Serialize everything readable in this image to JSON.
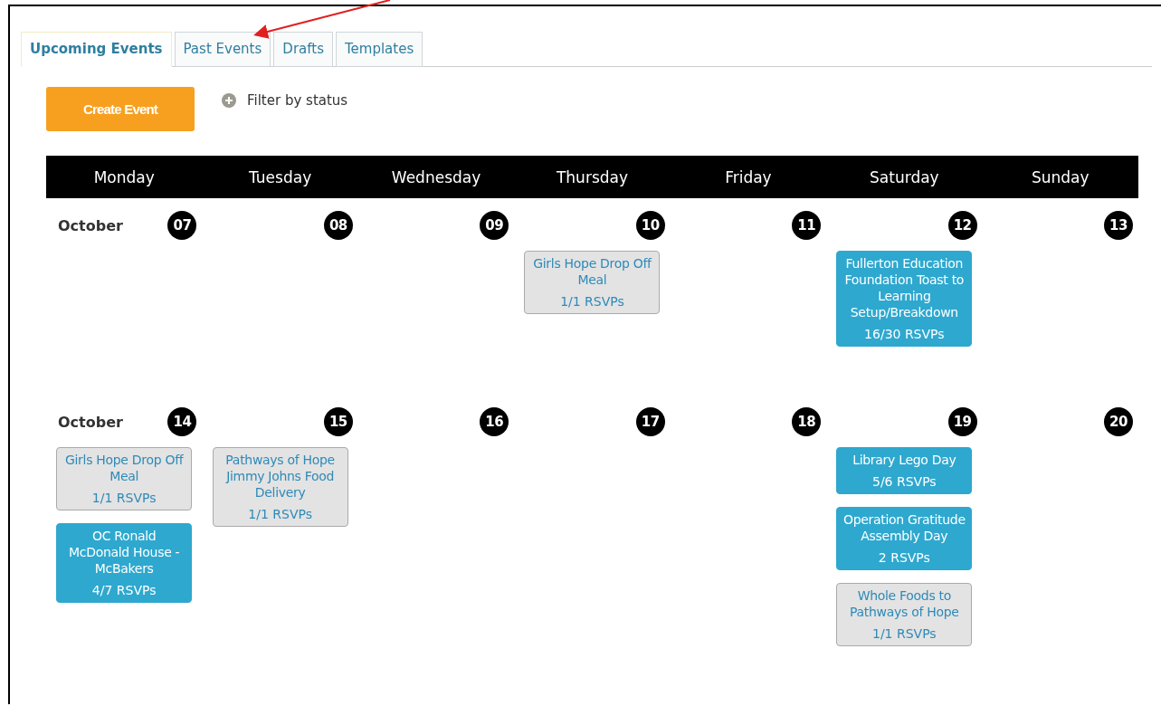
{
  "tabs": [
    {
      "label": "Upcoming Events",
      "selected": true
    },
    {
      "label": "Past Events",
      "selected": false
    },
    {
      "label": "Drafts",
      "selected": false
    },
    {
      "label": "Templates",
      "selected": false
    }
  ],
  "create_button": "Create Event",
  "filter": {
    "label": "Filter by status",
    "expanded": false
  },
  "weekdays": [
    "Monday",
    "Tuesday",
    "Wednesday",
    "Thursday",
    "Friday",
    "Saturday",
    "Sunday"
  ],
  "weeks": [
    {
      "month": "October",
      "days": [
        {
          "number": "07"
        },
        {
          "number": "08"
        },
        {
          "number": "09"
        },
        {
          "number": "10",
          "events": [
            {
              "title": "Girls Hope Drop Off Meal",
              "rsvps": "1/1 RSVPs",
              "highlighted": false
            }
          ]
        },
        {
          "number": "11"
        },
        {
          "number": "12",
          "events": [
            {
              "title": "Fullerton Education Foundation Toast to Learning Setup/Breakdown",
              "rsvps": "16/30 RSVPs",
              "highlighted": true
            }
          ]
        },
        {
          "number": "13"
        }
      ]
    },
    {
      "month": "October",
      "days": [
        {
          "number": "14",
          "events": [
            {
              "title": "Girls Hope Drop Off Meal",
              "rsvps": "1/1 RSVPs",
              "highlighted": false
            },
            {
              "title": "OC Ronald McDonald House - McBakers",
              "rsvps": "4/7 RSVPs",
              "highlighted": true
            }
          ]
        },
        {
          "number": "15",
          "events": [
            {
              "title": "Pathways of Hope Jimmy Johns Food Delivery",
              "rsvps": "1/1 RSVPs",
              "highlighted": false
            }
          ]
        },
        {
          "number": "16"
        },
        {
          "number": "17"
        },
        {
          "number": "18"
        },
        {
          "number": "19",
          "events": [
            {
              "title": "Library Lego Day",
              "rsvps": "5/6 RSVPs",
              "highlighted": true
            },
            {
              "title": "Operation Gratitude Assembly Day",
              "rsvps": "2 RSVPs",
              "highlighted": true
            },
            {
              "title": "Whole Foods to Pathways of Hope",
              "rsvps": "1/1 RSVPs",
              "highlighted": false
            }
          ]
        },
        {
          "number": "20"
        }
      ]
    }
  ]
}
